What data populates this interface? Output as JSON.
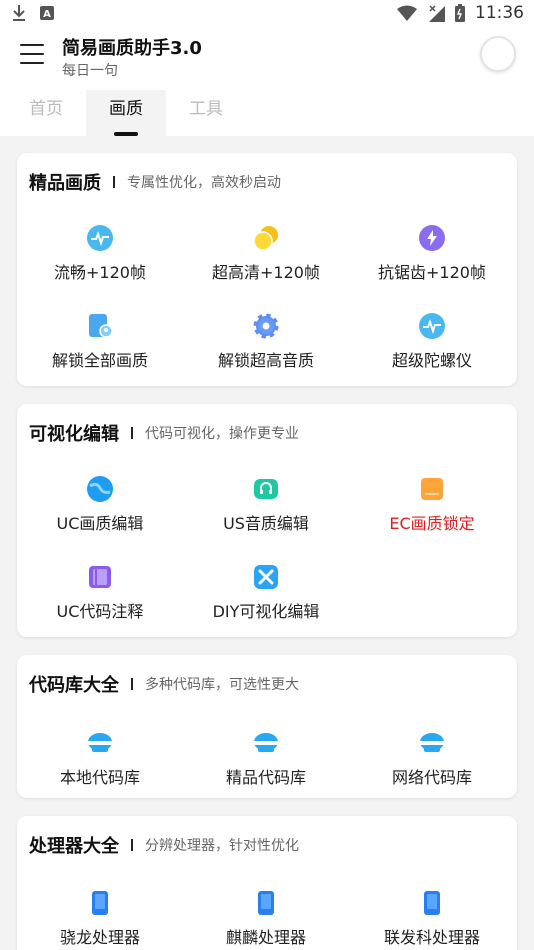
{
  "status": {
    "time": "11:36"
  },
  "header": {
    "title": "简易画质助手3.0",
    "subtitle": "每日一句"
  },
  "tabs": [
    {
      "label": "首页"
    },
    {
      "label": "画质"
    },
    {
      "label": "工具"
    }
  ],
  "cards": [
    {
      "title": "精品画质",
      "desc": "专属性优化，高效秒启动",
      "items": [
        {
          "label": "流畅+120帧",
          "icon": "pulse-icon"
        },
        {
          "label": "超高清+120帧",
          "icon": "coins-icon"
        },
        {
          "label": "抗锯齿+120帧",
          "icon": "bolt-icon"
        },
        {
          "label": "解锁全部画质",
          "icon": "doc-location-icon"
        },
        {
          "label": "解锁超高音质",
          "icon": "gear-icon"
        },
        {
          "label": "超级陀螺仪",
          "icon": "pulse-icon"
        }
      ]
    },
    {
      "title": "可视化编辑",
      "desc": "代码可视化，操作更专业",
      "items": [
        {
          "label": "UC画质编辑",
          "icon": "globe-icon"
        },
        {
          "label": "US音质编辑",
          "icon": "headphones-icon"
        },
        {
          "label": "EC画质锁定",
          "icon": "folder-icon",
          "color": "#e02020"
        },
        {
          "label": "UC代码注释",
          "icon": "book-icon"
        },
        {
          "label": "DIY可视化编辑",
          "icon": "tools-icon"
        }
      ]
    },
    {
      "title": "代码库大全",
      "desc": "多种代码库，可选性更大",
      "items": [
        {
          "label": "本地代码库",
          "icon": "cloud-icon"
        },
        {
          "label": "精品代码库",
          "icon": "cloud-icon"
        },
        {
          "label": "网络代码库",
          "icon": "cloud-icon"
        }
      ]
    },
    {
      "title": "处理器大全",
      "desc": "分辨处理器，针对性优化",
      "items": [
        {
          "label": "骁龙处理器",
          "icon": "phone-icon"
        },
        {
          "label": "麒麟处理器",
          "icon": "phone-icon"
        },
        {
          "label": "联发科处理器",
          "icon": "phone-icon"
        }
      ]
    }
  ]
}
